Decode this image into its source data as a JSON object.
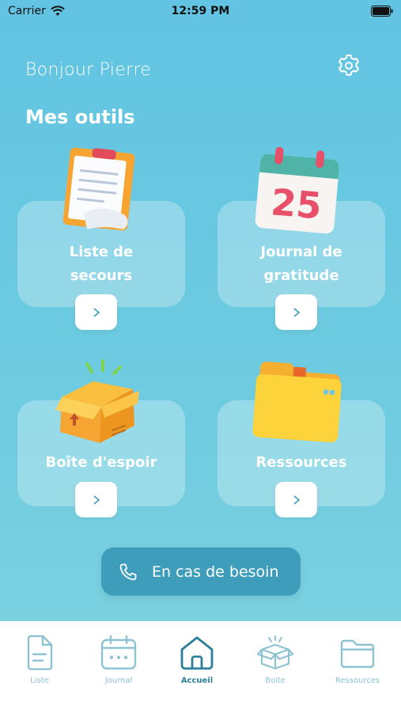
{
  "status_bar": {
    "carrier": "Carrier",
    "time": "12:59 PM"
  },
  "greeting": "Bonjour Pierre",
  "section_title": "Mes outils",
  "cards": [
    {
      "label_line1": "Liste de",
      "label_line2": "secours",
      "button": ">",
      "icon": "clipboard-icon"
    },
    {
      "label_line1": "Journal de",
      "label_line2": "gratitude",
      "button": ">",
      "icon": "calendar-icon",
      "calendar_day": "25"
    },
    {
      "label": "Boîte d'espoir",
      "button": ">",
      "icon": "box-icon"
    },
    {
      "label": "Ressources",
      "button": ">",
      "icon": "folder-icon"
    }
  ],
  "help_button": {
    "label": "En cas de besoin",
    "icon": "phone-icon"
  },
  "tabs": [
    {
      "label": "Liste",
      "icon": "document-icon",
      "active": false
    },
    {
      "label": "Journal",
      "icon": "calendar-icon",
      "active": false
    },
    {
      "label": "Accueil",
      "icon": "home-icon",
      "active": true
    },
    {
      "label": "Boite",
      "icon": "box-icon",
      "active": false
    },
    {
      "label": "Ressources",
      "icon": "folder-icon",
      "active": false
    }
  ],
  "colors": {
    "background_top": "#62c4e2",
    "background_bottom": "#7fd3df",
    "help_button": "#3d9dba",
    "tab_inactive": "#8ec3d2",
    "tab_active": "#2c7f9b",
    "chevron": "#3d9dba"
  }
}
